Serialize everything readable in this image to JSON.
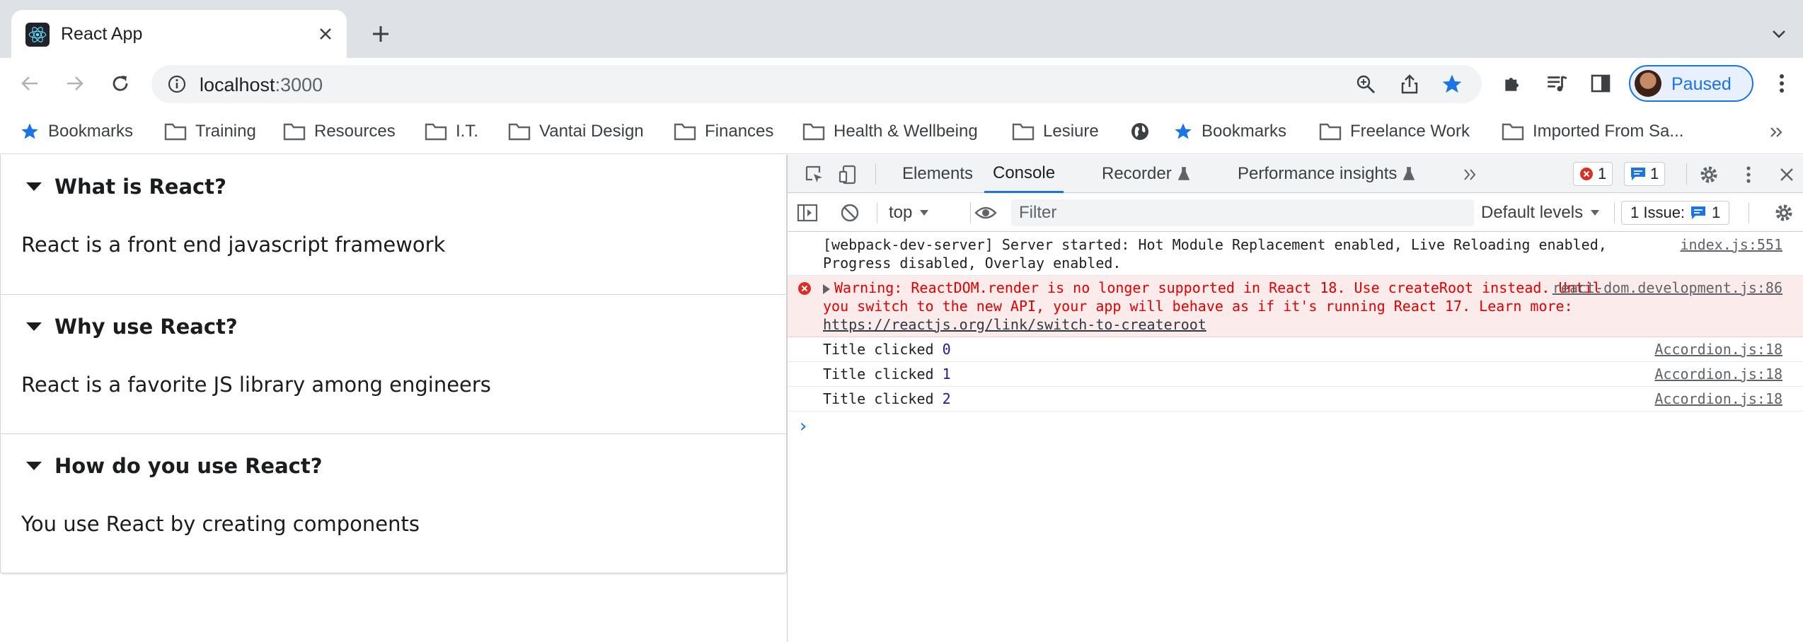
{
  "browser": {
    "tab": {
      "title": "React App",
      "favicon": "react-logo-icon"
    },
    "address": {
      "host": "localhost",
      "port": ":3000"
    },
    "profile": {
      "label": "Paused"
    }
  },
  "bookmarks": [
    {
      "label": "Bookmarks",
      "icon": "star-icon"
    },
    {
      "label": "Training",
      "icon": "folder-icon"
    },
    {
      "label": "Resources",
      "icon": "folder-icon"
    },
    {
      "label": "I.T.",
      "icon": "folder-icon"
    },
    {
      "label": "Vantai Design",
      "icon": "folder-icon"
    },
    {
      "label": "Finances",
      "icon": "folder-icon"
    },
    {
      "label": "Health & Wellbeing",
      "icon": "folder-icon"
    },
    {
      "label": "Lesiure",
      "icon": "folder-icon"
    },
    {
      "label": "",
      "icon": "globe-icon"
    },
    {
      "label": "Bookmarks",
      "icon": "star-icon"
    },
    {
      "label": "Freelance Work",
      "icon": "folder-icon"
    },
    {
      "label": "Imported From Sa...",
      "icon": "folder-icon"
    }
  ],
  "accordion": [
    {
      "title": "What is React?",
      "content": "React is a front end javascript framework"
    },
    {
      "title": "Why use React?",
      "content": "React is a favorite JS library among engineers"
    },
    {
      "title": "How do you use React?",
      "content": "You use React by creating components"
    }
  ],
  "devtools": {
    "tabs": {
      "elements": "Elements",
      "console": "Console",
      "recorder": "Recorder",
      "performance": "Performance insights"
    },
    "error_count": "1",
    "message_count": "1",
    "context": "top",
    "filter_placeholder": "Filter",
    "levels": "Default levels",
    "issues_label": "1 Issue:",
    "issues_count": "1",
    "messages": {
      "server": {
        "text": "[webpack-dev-server] Server started: Hot Module Replacement enabled, Live Reloading enabled, Progress disabled, Overlay enabled.",
        "source": "index.js:551"
      },
      "warning": {
        "text": "Warning: ReactDOM.render is no longer supported in React 18. Use createRoot instead. Until you switch to the new API, your app will behave as if it's running React 17. Learn more: ",
        "link": "https://reactjs.org/link/switch-to-createroot",
        "source": "react-dom.development.js:86"
      },
      "logs": [
        {
          "text": "Title clicked ",
          "value": "0",
          "source": "Accordion.js:18"
        },
        {
          "text": "Title clicked ",
          "value": "1",
          "source": "Accordion.js:18"
        },
        {
          "text": "Title clicked ",
          "value": "2",
          "source": "Accordion.js:18"
        }
      ]
    }
  }
}
